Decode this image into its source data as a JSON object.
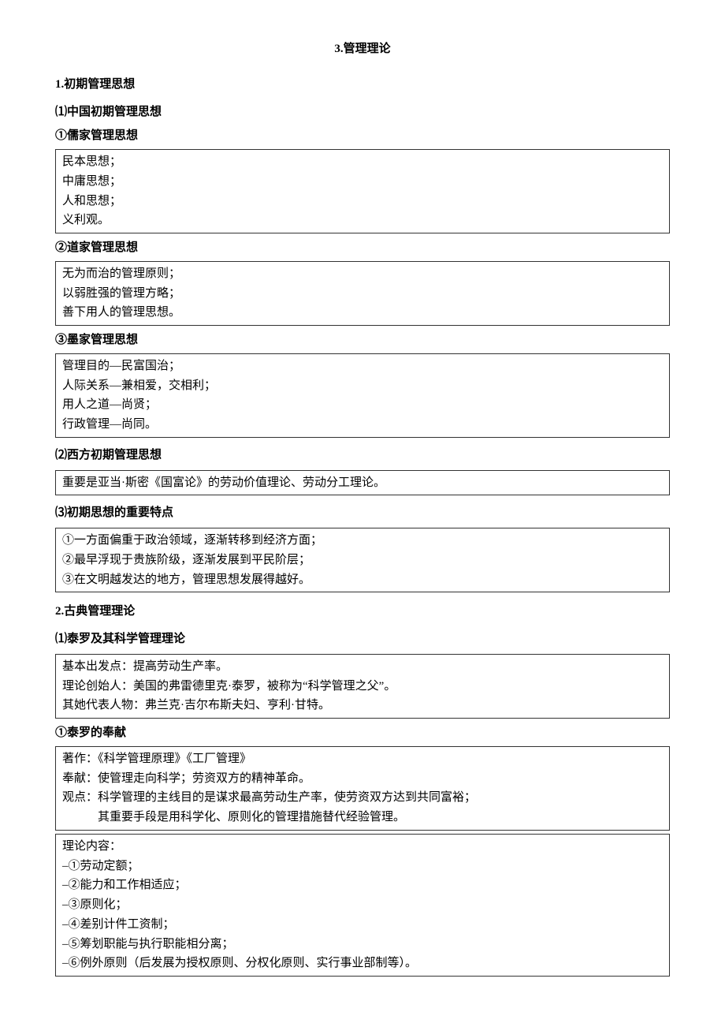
{
  "title": "3.管理理论",
  "s1": {
    "heading": "1.初期管理思想",
    "sub1": {
      "heading": "⑴中国初期管理思想",
      "a": {
        "heading": "①儒家管理思想",
        "lines": [
          "民本思想；",
          "中庸思想；",
          "人和思想；",
          "义利观。"
        ]
      },
      "b": {
        "heading": "②道家管理思想",
        "lines": [
          "无为而治的管理原则；",
          "以弱胜强的管理方略；",
          "善下用人的管理思想。"
        ]
      },
      "c": {
        "heading": "③墨家管理思想",
        "lines": [
          "管理目的—民富国治；",
          "人际关系—兼相爱，交相利；",
          "用人之道—尚贤；",
          "行政管理—尚同。"
        ]
      }
    },
    "sub2": {
      "heading": "⑵西方初期管理思想",
      "lines": [
        "重要是亚当·斯密《国富论》的劳动价值理论、劳动分工理论。"
      ]
    },
    "sub3": {
      "heading": "⑶初期思想的重要特点",
      "lines": [
        "①一方面偏重于政治领域，逐渐转移到经济方面；",
        "②最早浮现于贵族阶级，逐渐发展到平民阶层；",
        "③在文明越发达的地方，管理思想发展得越好。"
      ]
    }
  },
  "s2": {
    "heading": "2.古典管理理论",
    "sub1": {
      "heading": "⑴泰罗及其科学管理理论",
      "intro": [
        "基本出发点：提高劳动生产率。",
        "理论创始人：美国的弗雷德里克·泰罗，被称为“科学管理之父”。",
        "其她代表人物：弗兰克·吉尔布斯夫妇、亨利·甘特。"
      ],
      "a": {
        "heading": "①泰罗的奉献",
        "box1": [
          "著作：《科学管理原理》《工厂管理》",
          "奉献：使管理走向科学；劳资双方的精神革命。",
          "观点：科学管理的主线目的是谋求最高劳动生产率，使劳资双方达到共同富裕；",
          "　　　其重要手段是用科学化、原则化的管理措施替代经验管理。"
        ],
        "box2": [
          "理论内容：",
          "–①劳动定额；",
          "–②能力和工作相适应；",
          "–③原则化；",
          "–④差别计件工资制；",
          "–⑤筹划职能与执行职能相分离；",
          "–⑥例外原则（后发展为授权原则、分权化原则、实行事业部制等）。"
        ]
      }
    }
  }
}
